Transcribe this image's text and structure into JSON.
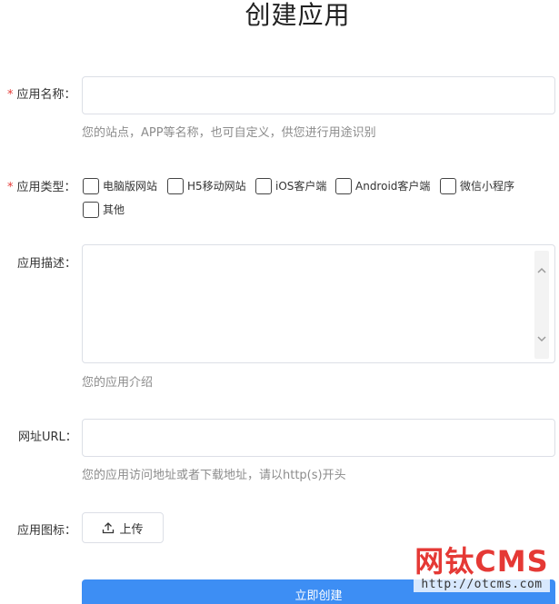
{
  "page": {
    "title": "创建应用",
    "submit_label": "立即创建"
  },
  "fields": {
    "name": {
      "required_mark": "*",
      "label": "应用名称：",
      "value": "",
      "help": "您的站点，APP等名称，也可自定义，供您进行用途识别"
    },
    "type": {
      "required_mark": "*",
      "label": "应用类型：",
      "options": [
        "电脑版网站",
        "H5移动网站",
        "iOS客户端",
        "Android客户端",
        "微信小程序",
        "其他"
      ]
    },
    "description": {
      "label": "应用描述：",
      "value": "",
      "help": "您的应用介绍"
    },
    "url": {
      "label": "网址URL：",
      "value": "",
      "help": "您的应用访问地址或者下载地址，请以http(s)开头"
    },
    "icon": {
      "label": "应用图标：",
      "upload_label": "上传"
    }
  },
  "watermark": {
    "logo_text": "网钛CMS",
    "url": "http://otcms.com"
  },
  "colors": {
    "primary": "#3d8ef4",
    "required": "#e53935",
    "border": "#dcdfe6",
    "help_text": "#8c8c8c",
    "watermark": "#e53935"
  },
  "icons": {
    "upload": "upload-icon",
    "scroll_up": "chevron-up-icon",
    "scroll_down": "chevron-down-icon"
  }
}
